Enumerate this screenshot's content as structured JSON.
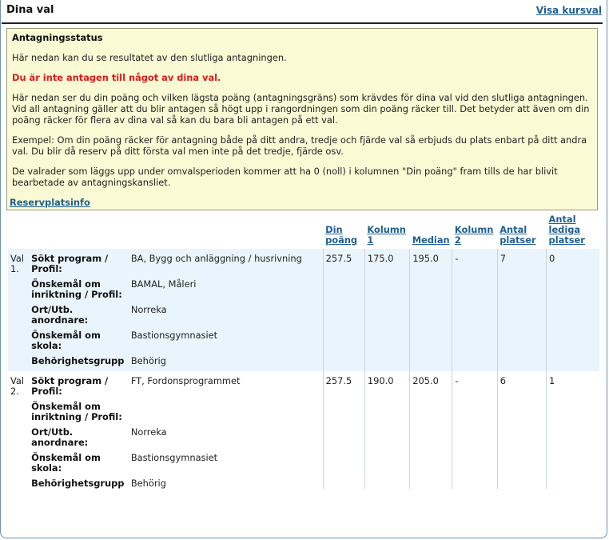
{
  "header": {
    "title": "Dina val",
    "visa_link": "Visa kursval"
  },
  "status": {
    "heading": "Antagningsstatus",
    "intro": "Här nedan kan du se resultatet av den slutliga antagningen.",
    "alert": "Du är inte antagen till något av dina val.",
    "para1": "Här nedan ser du din poäng och vilken lägsta poäng (antagningsgräns) som krävdes för dina val vid den slutliga antagningen. Vid all antagning gäller att du blir antagen så högt upp i rangordningen som din poäng räcker till. Det betyder att även om din poäng räcker för flera av dina val så kan du bara bli antagen på ett val.",
    "para2": "Exempel: Om din poäng räcker för antagning både på ditt andra, tredje och fjärde val så erbjuds du plats enbart på ditt andra val. Du blir då reserv på ditt första val men inte på det tredje, fjärde osv.",
    "para3": "De valrader som läggs upp under omvalsperioden kommer att ha 0 (noll) i kolumnen \"Din poäng\" fram tills de har blivit bearbetade av antagningskansliet.",
    "link": "Reservplatsinfo"
  },
  "table": {
    "columns": {
      "din_poang": "Din poäng",
      "kolumn1": "Kolumn 1",
      "median": "Median",
      "kolumn2": "Kolumn 2",
      "antal_platser": "Antal platser",
      "antal_lediga": "Antal lediga platser"
    },
    "labels": {
      "program": "Sökt program / Profil:",
      "inriktning": "Önskemål om inriktning / Profil:",
      "ort": "Ort/Utb. anordnare:",
      "skola": "Önskemål om skola:",
      "behorighet": "Behörighetsgrupp"
    },
    "rows": [
      {
        "val": "Val 1.",
        "program": "BA, Bygg och anläggning / husrivning",
        "inriktning": "BAMAL, Måleri",
        "ort": "Norreka",
        "skola": "Bastionsgymnasiet",
        "behorighet": "Behörig",
        "din_poang": "257.5",
        "kolumn1": "175.0",
        "median": "195.0",
        "kolumn2": "-",
        "antal_platser": "7",
        "antal_lediga": "0"
      },
      {
        "val": "Val 2.",
        "program": "FT, Fordonsprogrammet",
        "inriktning": "",
        "ort": "Norreka",
        "skola": "Bastionsgymnasiet",
        "behorighet": "Behörig",
        "din_poang": "257.5",
        "kolumn1": "190.0",
        "median": "205.0",
        "kolumn2": "-",
        "antal_platser": "6",
        "antal_lediga": "1"
      }
    ]
  }
}
